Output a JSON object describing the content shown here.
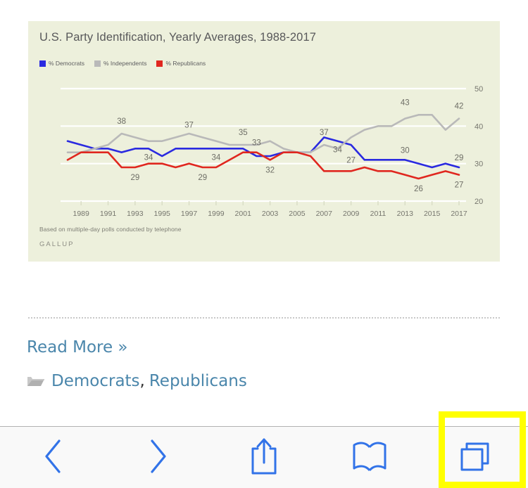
{
  "chart_data": {
    "type": "line",
    "title": "U.S. Party Identification, Yearly Averages, 1988-2017",
    "footnote": "Based on multiple-day polls conducted by telephone",
    "brand": "GALLUP",
    "xlabel": "",
    "ylabel": "",
    "ylim": [
      20,
      50
    ],
    "yticks": [
      20,
      30,
      40,
      50
    ],
    "grid": true,
    "legend_position": "top-left",
    "x": [
      1988,
      1989,
      1990,
      1991,
      1992,
      1993,
      1994,
      1995,
      1996,
      1997,
      1998,
      1999,
      2000,
      2001,
      2002,
      2003,
      2004,
      2005,
      2006,
      2007,
      2008,
      2009,
      2010,
      2011,
      2012,
      2013,
      2014,
      2015,
      2016,
      2017
    ],
    "xticks": [
      1989,
      1991,
      1993,
      1995,
      1997,
      1999,
      2001,
      2003,
      2005,
      2007,
      2009,
      2011,
      2013,
      2015,
      2017
    ],
    "series": [
      {
        "name": "% Democrats",
        "color": "#2a2ae0",
        "values": [
          36,
          35,
          34,
          34,
          33,
          34,
          34,
          32,
          34,
          34,
          34,
          34,
          34,
          34,
          32,
          32,
          33,
          33,
          33,
          37,
          36,
          35,
          31,
          31,
          31,
          31,
          30,
          29,
          30,
          29
        ]
      },
      {
        "name": "% Independents",
        "color": "#b9b9b9",
        "values": [
          33,
          33,
          34,
          35,
          38,
          37,
          36,
          36,
          37,
          38,
          37,
          36,
          35,
          35,
          35,
          36,
          34,
          33,
          33,
          35,
          34,
          37,
          39,
          40,
          40,
          42,
          43,
          43,
          39,
          42
        ]
      },
      {
        "name": "% Republicans",
        "color": "#e0271f",
        "values": [
          31,
          33,
          33,
          33,
          29,
          29,
          30,
          30,
          29,
          30,
          29,
          29,
          31,
          33,
          33,
          31,
          33,
          33,
          32,
          28,
          28,
          28,
          29,
          28,
          28,
          27,
          26,
          27,
          28,
          27
        ]
      }
    ],
    "annotations": [
      {
        "label": "38",
        "x": 1992,
        "y": 38,
        "dy": -14
      },
      {
        "label": "37",
        "x": 1997,
        "y": 37,
        "dy": -14
      },
      {
        "label": "35",
        "x": 2001,
        "y": 35,
        "dy": -14
      },
      {
        "label": "33",
        "x": 2002,
        "y": 33,
        "dy": -10
      },
      {
        "label": "37",
        "x": 2007,
        "y": 35,
        "dy": -14
      },
      {
        "label": "43",
        "x": 2013,
        "y": 43,
        "dy": -14
      },
      {
        "label": "42",
        "x": 2017,
        "y": 42,
        "dy": -14
      },
      {
        "label": "34",
        "x": 1994,
        "y": 34,
        "dy": 16
      },
      {
        "label": "34",
        "x": 1999,
        "y": 34,
        "dy": 16
      },
      {
        "label": "34",
        "x": 2008,
        "y": 36,
        "dy": 16
      },
      {
        "label": "30",
        "x": 2013,
        "y": 31,
        "dy": -10
      },
      {
        "label": "29",
        "x": 2017,
        "y": 29,
        "dy": -10
      },
      {
        "label": "29",
        "x": 1993,
        "y": 29,
        "dy": 18
      },
      {
        "label": "29",
        "x": 1998,
        "y": 29,
        "dy": 18
      },
      {
        "label": "32",
        "x": 2003,
        "y": 31,
        "dy": 18
      },
      {
        "label": "27",
        "x": 2009,
        "y": 28,
        "dy": -12
      },
      {
        "label": "26",
        "x": 2014,
        "y": 26,
        "dy": 18
      },
      {
        "label": "27",
        "x": 2017,
        "y": 27,
        "dy": 18
      }
    ]
  },
  "article": {
    "read_more": "Read More »",
    "folder_icon": "folder-icon",
    "categories": [
      {
        "label": "Democrats"
      },
      {
        "label": "Republicans"
      }
    ],
    "category_separator": ","
  },
  "toolbar": {
    "buttons": [
      {
        "name": "back-button",
        "icon": "chevron-left-icon",
        "label": "Back"
      },
      {
        "name": "forward-button",
        "icon": "chevron-right-icon",
        "label": "Forward"
      },
      {
        "name": "share-button",
        "icon": "share-icon",
        "label": "Share"
      },
      {
        "name": "bookmarks-button",
        "icon": "book-icon",
        "label": "Bookmarks"
      },
      {
        "name": "tabs-button",
        "icon": "tabs-icon",
        "label": "Tabs"
      }
    ],
    "accent_color": "#3273e8",
    "highlight_color": "#ffff00",
    "highlighted_button": "tabs-button"
  }
}
